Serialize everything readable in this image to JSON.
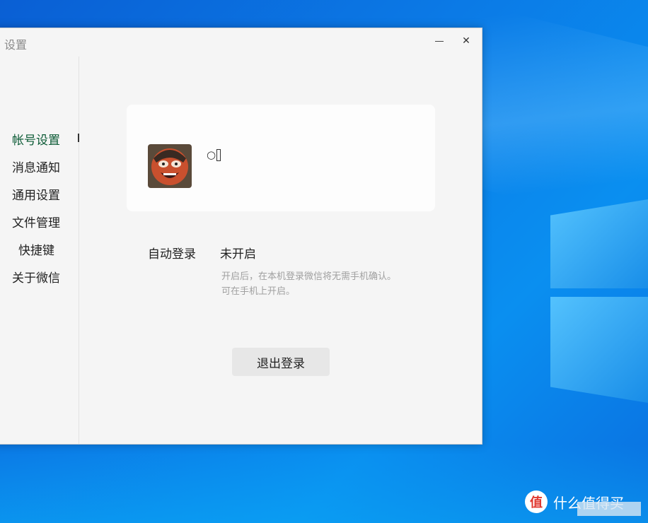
{
  "window": {
    "title": "设置",
    "minimize_icon": "minimize-icon",
    "close_icon": "close-icon",
    "close_glyph": "✕"
  },
  "sidebar": {
    "items": [
      {
        "label": "帐号设置",
        "active": true
      },
      {
        "label": "消息通知"
      },
      {
        "label": "通用设置"
      },
      {
        "label": "文件管理"
      },
      {
        "label": "快捷键"
      },
      {
        "label": "关于微信"
      }
    ]
  },
  "account": {
    "nickname": "○",
    "avatar_icon": "avatar-image"
  },
  "auto_login": {
    "label": "自动登录",
    "value": "未开启",
    "description_line1": "开启后，在本机登录微信将无需手机确认。",
    "description_line2": "可在手机上开启。"
  },
  "logout_button": "退出登录",
  "watermark": {
    "icon_glyph": "值",
    "text": "什么值得买"
  },
  "colors": {
    "active_nav": "#0b5a35",
    "window_bg": "#f5f5f5",
    "card_bg": "#fdfdfd",
    "button_bg": "#e7e7e7"
  }
}
